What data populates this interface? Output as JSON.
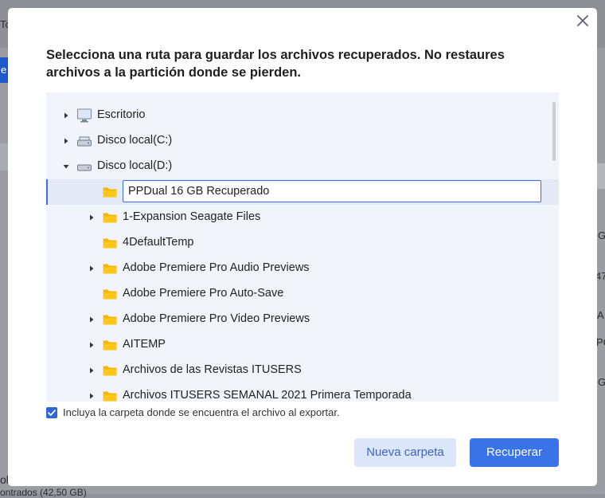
{
  "background": {
    "top_left_fragment": "To",
    "blue_tab_fragment": "e",
    "right_fragments": [
      "G",
      "47",
      "A",
      "PC",
      "G"
    ],
    "bottom_left_fragment": "ole",
    "bottom_status_fragment": "ontrados (42,50 GB)"
  },
  "dialog": {
    "title": "Selecciona una ruta para guardar los archivos recuperados. No restaures archivos a la partición donde se pierden.",
    "tree": [
      {
        "label": "Escritorio",
        "icon": "desktop-icon",
        "arrow": "collapsed"
      },
      {
        "label": "Disco local(C:)",
        "icon": "drive-icon",
        "arrow": "collapsed"
      },
      {
        "label": "Disco local(D:)",
        "icon": "drive-icon",
        "arrow": "expanded"
      },
      {
        "label": "",
        "icon": "folder-icon",
        "arrow": "none",
        "editing": true
      },
      {
        "label": "1-Expansion Seagate Files",
        "icon": "folder-icon",
        "arrow": "collapsed"
      },
      {
        "label": "4DefaultTemp",
        "icon": "folder-icon",
        "arrow": "none"
      },
      {
        "label": "Adobe Premiere Pro Audio Previews",
        "icon": "folder-icon",
        "arrow": "collapsed"
      },
      {
        "label": "Adobe Premiere Pro Auto-Save",
        "icon": "folder-icon",
        "arrow": "none"
      },
      {
        "label": "Adobe Premiere Pro Video Previews",
        "icon": "folder-icon",
        "arrow": "collapsed"
      },
      {
        "label": "AITEMP",
        "icon": "folder-icon",
        "arrow": "collapsed"
      },
      {
        "label": "Archivos de las Revistas ITUSERS",
        "icon": "folder-icon",
        "arrow": "collapsed"
      },
      {
        "label": "Archivos ITUSERS SEMANAL 2021 Primera Temporada",
        "icon": "folder-icon",
        "arrow": "collapsed"
      }
    ],
    "rename_value": "PPDual 16 GB Recuperado",
    "include_folder_checked": true,
    "include_folder_label": "Incluya la carpeta donde se encuentra el archivo al exportar.",
    "new_folder_label": "Nueva carpeta",
    "recover_label": "Recuperar"
  },
  "colors": {
    "accent": "#3a73e8",
    "folder": "#f7b500",
    "panel": "#f1f4fa"
  }
}
